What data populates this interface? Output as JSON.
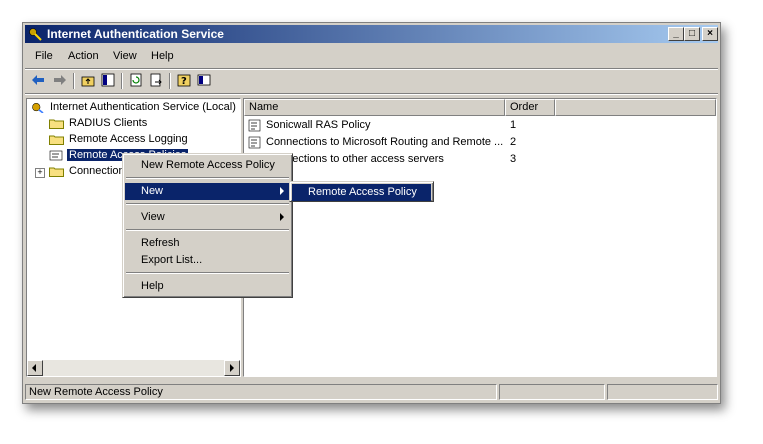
{
  "window": {
    "title": "Internet Authentication Service"
  },
  "menubar": {
    "items": [
      "File",
      "Action",
      "View",
      "Help"
    ]
  },
  "tree": {
    "root": "Internet Authentication Service (Local)",
    "items": [
      "RADIUS Clients",
      "Remote Access Logging",
      "Remote Access Policies",
      "Connection Request Processing"
    ]
  },
  "list": {
    "columns": [
      "Name",
      "Order"
    ],
    "rows": [
      {
        "name": "Sonicwall RAS Policy",
        "order": "1"
      },
      {
        "name": "Connections to Microsoft Routing and Remote ...",
        "order": "2"
      },
      {
        "name": "Connections to other access servers",
        "order": "3"
      }
    ]
  },
  "context_menu": {
    "items": [
      "New Remote Access Policy",
      "New",
      "View",
      "Refresh",
      "Export List...",
      "Help"
    ]
  },
  "submenu": {
    "items": [
      "Remote Access Policy"
    ]
  },
  "statusbar": {
    "text": "New Remote Access Policy"
  },
  "colors": {
    "title_start": "#0a246a",
    "title_end": "#a6caf0",
    "selection": "#0a246a",
    "face": "#d4d0c8"
  }
}
